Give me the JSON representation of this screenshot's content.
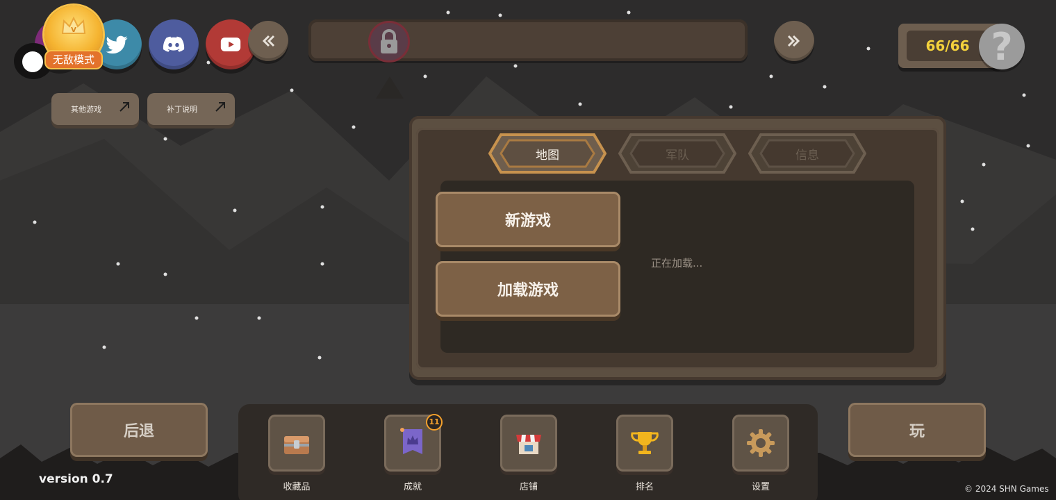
{
  "colors": {
    "sky": "#2d2c2c",
    "panel": "#5c4f41",
    "button": "#7d6146",
    "counter_text": "#f4d23c",
    "badge": "#f3a02c"
  },
  "header": {
    "vip_mode_label": "无敌模式",
    "social_links": [
      {
        "name": "purple-circle",
        "icon": "circle-icon"
      },
      {
        "name": "twitter",
        "icon": "twitter-icon"
      },
      {
        "name": "discord",
        "icon": "discord-icon"
      },
      {
        "name": "youtube",
        "icon": "youtube-icon"
      }
    ],
    "counter": "66/66",
    "avatar_glyph": "?"
  },
  "links": {
    "other_games": "其他游戏",
    "patch_notes": "补丁说明"
  },
  "panel": {
    "tabs": [
      {
        "label": "地图",
        "active": true
      },
      {
        "label": "军队",
        "active": false
      },
      {
        "label": "信息",
        "active": false
      }
    ],
    "new_game": "新游戏",
    "load_game": "加载游戏",
    "loading_text": "正在加载..."
  },
  "bottom": {
    "back_label": "后退",
    "play_label": "玩",
    "dock": [
      {
        "label": "收藏品",
        "icon": "treasure-chest-icon"
      },
      {
        "label": "成就",
        "icon": "crown-banner-icon",
        "badge": "11"
      },
      {
        "label": "店铺",
        "icon": "shop-icon"
      },
      {
        "label": "排名",
        "icon": "trophy-icon"
      },
      {
        "label": "设置",
        "icon": "gear-icon"
      }
    ]
  },
  "footer": {
    "version": "version 0.7",
    "copyright": "© 2024 SHN Games"
  }
}
